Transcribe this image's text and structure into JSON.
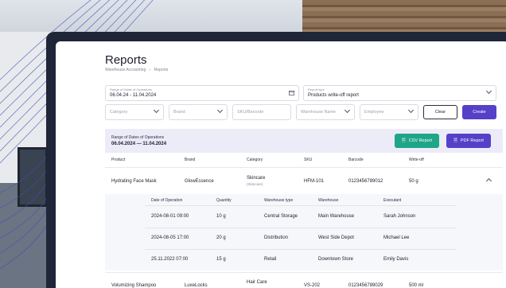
{
  "page": {
    "title": "Reports"
  },
  "breadcrumb": [
    "Warehouse Accounting",
    "Reports"
  ],
  "filters": {
    "date_range": {
      "label": "Range of Dates of Operations",
      "value": "06.04.24 - 11.04.2024"
    },
    "report_type": {
      "label": "Report type",
      "value": "Products write-off report"
    },
    "category_placeholder": "Category",
    "brand_placeholder": "Brand",
    "sku_placeholder": "SKU/Barcode",
    "warehouse_placeholder": "Warehouse Name",
    "employee_placeholder": "Employee",
    "clear_label": "Clear",
    "create_label": "Create"
  },
  "summary": {
    "label": "Range of Dates of Operations",
    "value": "06.04.2024 — 11.04.2024",
    "csv_label": "CSV Report",
    "pdf_label": "PDF Report"
  },
  "colors": {
    "accent": "#5540c8",
    "csv": "#1fa587",
    "summary_bg": "#ecebf8"
  },
  "table": {
    "columns": [
      "Product",
      "Brand",
      "Category",
      "SKU",
      "Barcode",
      "Write-off"
    ],
    "rows": [
      {
        "product": "Hydrating Face Mask",
        "brand": "GlowEssence",
        "category": "Skincare",
        "category_sub": "(Skincare)",
        "sku": "HFM-101",
        "barcode": "0123456789012",
        "writeoff": "50 g"
      },
      {
        "product": "Volumizing Shampoo",
        "brand": "LuxeLocks",
        "category": "Hair Care",
        "category_sub": "",
        "sku": "VS-202",
        "barcode": "0123456789029",
        "writeoff": "500 ml"
      }
    ]
  },
  "subtable": {
    "columns": [
      "Date of Operation",
      "Quantity",
      "Warehouse type",
      "Warehouse",
      "Executant"
    ],
    "rows": [
      {
        "date": "2024-08-01 09:00",
        "qty": "10 g",
        "type": "Central Storage",
        "warehouse": "Main Warehouse",
        "exec": "Sarah Johnson"
      },
      {
        "date": "2024-08-05 17:00",
        "qty": "20 g",
        "type": "Distribution",
        "warehouse": "West Side Depot",
        "exec": "Michael Lee"
      },
      {
        "date": "25.11.2022 07:00",
        "qty": "15 g",
        "type": "Retail",
        "warehouse": "Downtown Store",
        "exec": "Emily Davis"
      }
    ]
  }
}
